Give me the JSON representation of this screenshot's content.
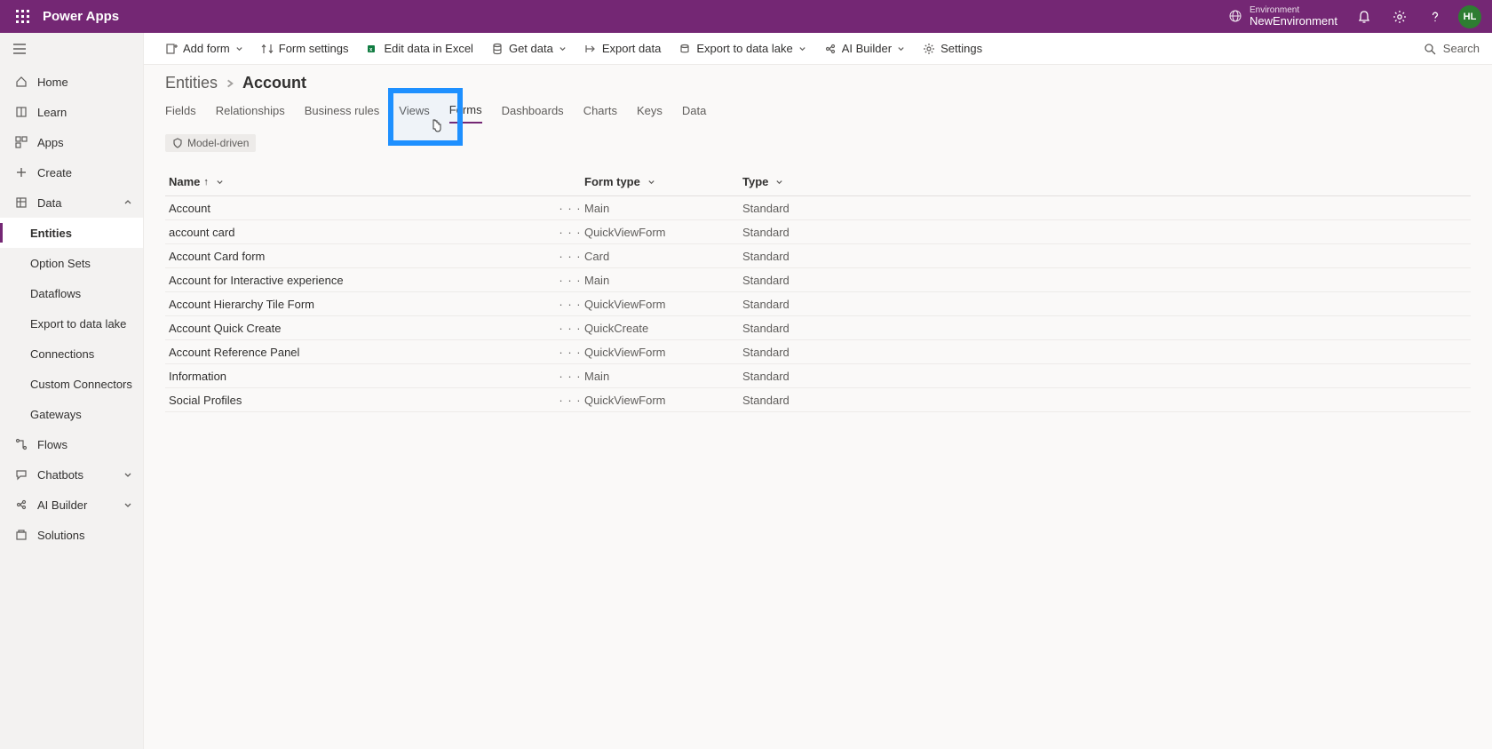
{
  "header": {
    "app_title": "Power Apps",
    "environment_label": "Environment",
    "environment_value": "NewEnvironment",
    "avatar_initials": "HL"
  },
  "sidebar": {
    "items": [
      {
        "label": "Home",
        "icon": "home"
      },
      {
        "label": "Learn",
        "icon": "learn"
      },
      {
        "label": "Apps",
        "icon": "apps"
      },
      {
        "label": "Create",
        "icon": "plus"
      },
      {
        "label": "Data",
        "icon": "data",
        "expanded": true
      },
      {
        "label": "Flows",
        "icon": "flows"
      },
      {
        "label": "Chatbots",
        "icon": "chat",
        "chev": true
      },
      {
        "label": "AI Builder",
        "icon": "ai",
        "chev": true
      },
      {
        "label": "Solutions",
        "icon": "solutions"
      }
    ],
    "data_children": [
      {
        "label": "Entities",
        "selected": true
      },
      {
        "label": "Option Sets"
      },
      {
        "label": "Dataflows"
      },
      {
        "label": "Export to data lake"
      },
      {
        "label": "Connections"
      },
      {
        "label": "Custom Connectors"
      },
      {
        "label": "Gateways"
      }
    ]
  },
  "commandbar": {
    "add_form": "Add form",
    "form_settings": "Form settings",
    "edit_excel": "Edit data in Excel",
    "get_data": "Get data",
    "export_data": "Export data",
    "export_lake": "Export to data lake",
    "ai_builder": "AI Builder",
    "settings": "Settings",
    "search_placeholder": "Search"
  },
  "breadcrumb": {
    "parent": "Entities",
    "current": "Account"
  },
  "tabs": [
    "Fields",
    "Relationships",
    "Business rules",
    "Views",
    "Forms",
    "Dashboards",
    "Charts",
    "Keys",
    "Data"
  ],
  "active_tab": "Forms",
  "filter_badge": "Model-driven",
  "grid": {
    "columns": {
      "name": "Name",
      "form_type": "Form type",
      "type": "Type"
    },
    "rows": [
      {
        "name": "Account",
        "form_type": "Main",
        "type": "Standard"
      },
      {
        "name": "account card",
        "form_type": "QuickViewForm",
        "type": "Standard"
      },
      {
        "name": "Account Card form",
        "form_type": "Card",
        "type": "Standard"
      },
      {
        "name": "Account for Interactive experience",
        "form_type": "Main",
        "type": "Standard"
      },
      {
        "name": "Account Hierarchy Tile Form",
        "form_type": "QuickViewForm",
        "type": "Standard"
      },
      {
        "name": "Account Quick Create",
        "form_type": "QuickCreate",
        "type": "Standard"
      },
      {
        "name": "Account Reference Panel",
        "form_type": "QuickViewForm",
        "type": "Standard"
      },
      {
        "name": "Information",
        "form_type": "Main",
        "type": "Standard"
      },
      {
        "name": "Social Profiles",
        "form_type": "QuickViewForm",
        "type": "Standard"
      }
    ]
  }
}
